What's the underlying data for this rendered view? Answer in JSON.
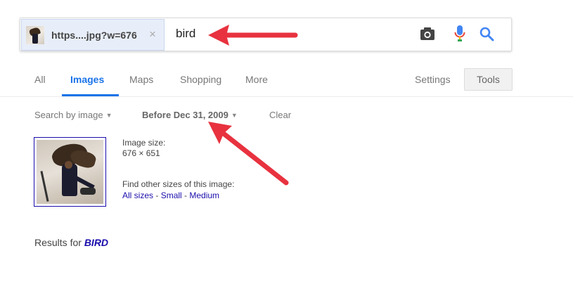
{
  "search": {
    "image_chip_text": "https....jpg?w=676",
    "chip_close_glyph": "×",
    "query": "bird"
  },
  "icons": {
    "camera": "camera-icon",
    "mic": "microphone-icon",
    "search": "search-icon"
  },
  "nav": {
    "tabs": [
      {
        "label": "All",
        "active": false
      },
      {
        "label": "Images",
        "active": true
      },
      {
        "label": "Maps",
        "active": false
      },
      {
        "label": "Shopping",
        "active": false
      },
      {
        "label": "More",
        "active": false
      }
    ],
    "settings_label": "Settings",
    "tools_label": "Tools"
  },
  "filters": {
    "search_by_image": "Search by image",
    "date_filter": "Before Dec 31, 2009",
    "clear": "Clear",
    "caret_glyph": "▼"
  },
  "image_info": {
    "size_label": "Image size:",
    "size_value": "676 × 651",
    "find_label": "Find other sizes of this image:",
    "links": [
      "All sizes",
      "Small",
      "Medium"
    ],
    "separator": " - "
  },
  "results": {
    "prefix": "Results for ",
    "term": "BIRD"
  },
  "colors": {
    "accent_blue": "#1a73e8",
    "link_blue": "#1a0dab",
    "annotation_red": "#e8323f",
    "mic_blue": "#4285f4",
    "mic_red": "#ea4335",
    "mic_yellow": "#fbbc05",
    "mic_green": "#34a853"
  }
}
